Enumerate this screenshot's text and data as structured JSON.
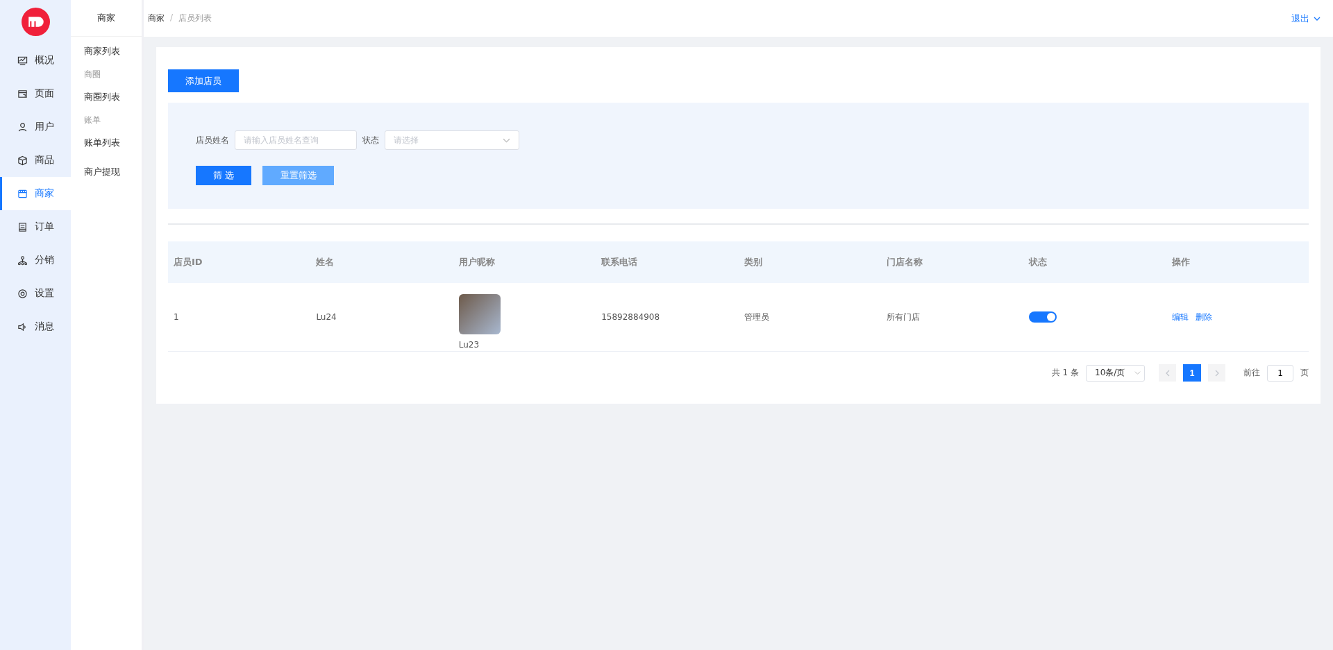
{
  "main_nav": [
    {
      "label": "概况",
      "selected": false
    },
    {
      "label": "页面",
      "selected": false
    },
    {
      "label": "用户",
      "selected": false
    },
    {
      "label": "商品",
      "selected": false
    },
    {
      "label": "商家",
      "selected": true
    },
    {
      "label": "订单",
      "selected": false
    },
    {
      "label": "分销",
      "selected": false
    },
    {
      "label": "设置",
      "selected": false
    },
    {
      "label": "消息",
      "selected": false
    }
  ],
  "sub_nav": {
    "title": "商家",
    "items": [
      {
        "kind": "link",
        "label": "商家列表"
      },
      {
        "kind": "group",
        "label": "商圈"
      },
      {
        "kind": "link",
        "label": "商圈列表"
      },
      {
        "kind": "group",
        "label": "账单"
      },
      {
        "kind": "link",
        "label": "账单列表"
      },
      {
        "kind": "link",
        "label": "商户提现"
      }
    ]
  },
  "breadcrumb": [
    "商家",
    "店员列表"
  ],
  "breadcrumb_separator": "/",
  "user_menu": "退出",
  "add_button": "添加店员",
  "filter": {
    "name_label": "店员姓名",
    "name_placeholder": "请输入店员姓名查询",
    "status_label": "状态",
    "status_placeholder": "请选择",
    "filter_button": "筛 选",
    "reset_button": "重置筛选"
  },
  "table": {
    "columns": [
      "店员ID",
      "姓名",
      "用户昵称",
      "联系电话",
      "类别",
      "门店名称",
      "状态",
      "操作"
    ],
    "rows": [
      {
        "id": "1",
        "name": "Lu24",
        "nickname": "Lu23",
        "phone": "15892884908",
        "category": "管理员",
        "store": "所有门店",
        "on": true,
        "actions": [
          "编辑",
          "删除"
        ]
      }
    ]
  },
  "pagination": {
    "total": "共 1 条",
    "page_size": "10条/页",
    "pages": [
      {
        "label": "1",
        "selected": true
      }
    ],
    "goto_label": "前往",
    "goto_value": "1",
    "page_suffix": "页"
  }
}
